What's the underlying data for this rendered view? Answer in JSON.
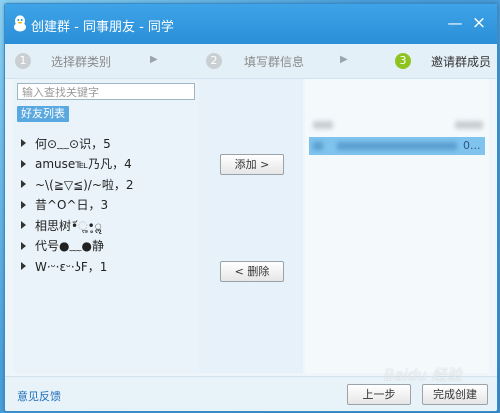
{
  "window": {
    "title": "创建群 - 同事朋友 - 同学",
    "minimize_icon": "minimize-icon",
    "close_icon": "close-icon"
  },
  "steps": [
    {
      "number": "1",
      "label": "选择群类别",
      "active": false
    },
    {
      "number": "2",
      "label": "填写群信息",
      "active": false
    },
    {
      "number": "3",
      "label": "邀请群成员",
      "active": true
    }
  ],
  "search": {
    "placeholder": "输入查找关键字"
  },
  "friend_list": {
    "tab_label": "好友列表",
    "groups": [
      {
        "name": "何⊙﹏⊙识，5"
      },
      {
        "name": "amuse℡乃凡，4"
      },
      {
        "name": "~\\(≧▽≦)/~啦，2"
      },
      {
        "name": "昔^O^日，3"
      },
      {
        "name": "相思树•᷄ૢ•̥ॢ"
      },
      {
        "name": "代号●﹏●静"
      },
      {
        "name": "W·ᵕ·εᵕ·ʖF，1"
      }
    ]
  },
  "actions": {
    "add_label": "添加 >",
    "remove_label": "< 删除"
  },
  "selected": {
    "row_suffix": "0..."
  },
  "footer": {
    "feedback_label": "意见反馈",
    "prev_label": "上一步",
    "finish_label": "完成创建"
  },
  "watermark": "Baidu 经验",
  "colors": {
    "title_bar": "#2f95dc",
    "step_active": "#8fc31f",
    "selection": "#7fc3ee"
  }
}
